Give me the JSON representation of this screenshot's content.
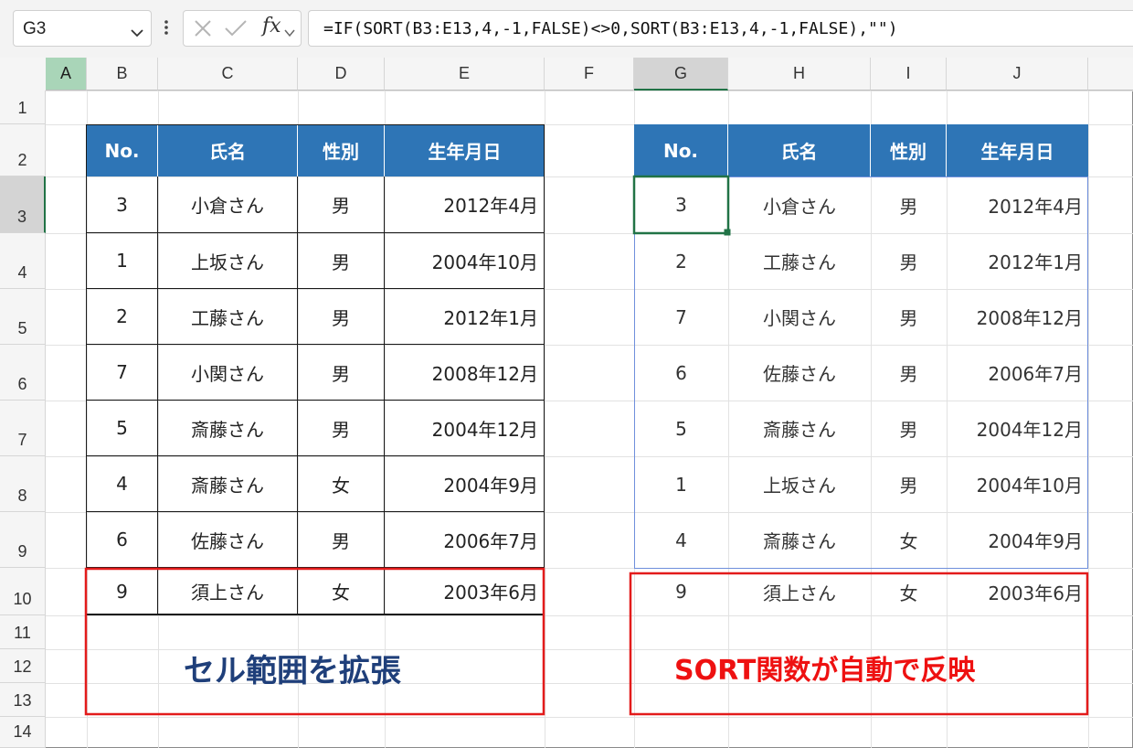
{
  "formula_bar": {
    "name_box": "G3",
    "formula": "=IF(SORT(B3:E13,4,-1,FALSE)<>0,SORT(B3:E13,4,-1,FALSE),\"\")",
    "fx_label": "fx"
  },
  "columns": [
    "A",
    "B",
    "C",
    "D",
    "E",
    "F",
    "G",
    "H",
    "I",
    "J"
  ],
  "rows": [
    "1",
    "2",
    "3",
    "4",
    "5",
    "6",
    "7",
    "8",
    "9",
    "10",
    "11",
    "12",
    "13",
    "14"
  ],
  "left_table": {
    "headers": [
      "No.",
      "氏名",
      "性別",
      "生年月日"
    ],
    "rows": [
      [
        "3",
        "小倉さん",
        "男",
        "2012年4月"
      ],
      [
        "1",
        "上坂さん",
        "男",
        "2004年10月"
      ],
      [
        "2",
        "工藤さん",
        "男",
        "2012年1月"
      ],
      [
        "7",
        "小関さん",
        "男",
        "2008年12月"
      ],
      [
        "5",
        "斎藤さん",
        "男",
        "2004年12月"
      ],
      [
        "4",
        "斎藤さん",
        "女",
        "2004年9月"
      ],
      [
        "6",
        "佐藤さん",
        "男",
        "2006年7月"
      ],
      [
        "9",
        "須上さん",
        "女",
        "2003年6月"
      ]
    ]
  },
  "right_table": {
    "headers": [
      "No.",
      "氏名",
      "性別",
      "生年月日"
    ],
    "rows": [
      [
        "3",
        "小倉さん",
        "男",
        "2012年4月"
      ],
      [
        "2",
        "工藤さん",
        "男",
        "2012年1月"
      ],
      [
        "7",
        "小関さん",
        "男",
        "2008年12月"
      ],
      [
        "6",
        "佐藤さん",
        "男",
        "2006年7月"
      ],
      [
        "5",
        "斎藤さん",
        "男",
        "2004年12月"
      ],
      [
        "1",
        "上坂さん",
        "男",
        "2004年10月"
      ],
      [
        "4",
        "斎藤さん",
        "女",
        "2004年9月"
      ],
      [
        "9",
        "須上さん",
        "女",
        "2003年6月"
      ]
    ]
  },
  "annotations": {
    "left": "セル範囲を拡張",
    "right": "SORT関数が自動で反映"
  },
  "colors": {
    "header_fill": "#2e75b6",
    "annotation_left": "#1f3f7a",
    "annotation_right": "#ee1111",
    "highlight_box": "#e31b1b",
    "selection": "#217346"
  },
  "icons": [
    "chevron-down-icon",
    "more-vert-icon",
    "cancel-icon",
    "enter-icon"
  ]
}
